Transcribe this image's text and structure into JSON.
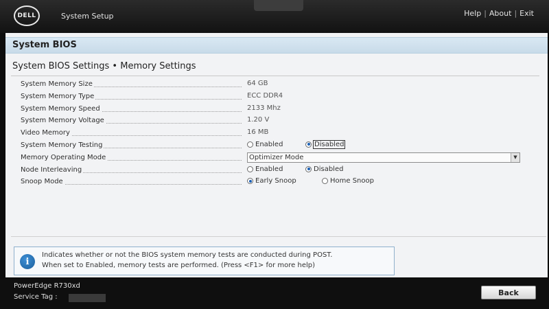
{
  "header": {
    "logo_text": "DELL",
    "app_title": "System Setup",
    "links": {
      "help": "Help",
      "about": "About",
      "exit": "Exit"
    },
    "separator": "|"
  },
  "section": {
    "title": "System BIOS"
  },
  "page": {
    "title": "System BIOS Settings • Memory Settings"
  },
  "settings": {
    "memory_size": {
      "label": "System Memory Size",
      "value": "64 GB"
    },
    "memory_type": {
      "label": "System Memory Type",
      "value": "ECC DDR4"
    },
    "memory_speed": {
      "label": "System Memory Speed",
      "value": "2133 Mhz"
    },
    "memory_voltage": {
      "label": "System Memory Voltage",
      "value": "1.20 V"
    },
    "video_memory": {
      "label": "Video Memory",
      "value": "16 MB"
    },
    "memory_testing": {
      "label": "System Memory Testing",
      "options": [
        "Enabled",
        "Disabled"
      ],
      "selected": "Disabled"
    },
    "operating_mode": {
      "label": "Memory Operating Mode",
      "selected": "Optimizer Mode"
    },
    "node_interleaving": {
      "label": "Node Interleaving",
      "options": [
        "Enabled",
        "Disabled"
      ],
      "selected": "Disabled"
    },
    "snoop_mode": {
      "label": "Snoop Mode",
      "options": [
        "Early Snoop",
        "Home Snoop"
      ],
      "selected": "Early Snoop"
    }
  },
  "help": {
    "line1": "Indicates whether or not the BIOS system memory tests are conducted during POST.",
    "line2": "When set to Enabled, memory tests are performed. (Press <F1> for more help)"
  },
  "footer": {
    "model": "PowerEdge R730xd",
    "service_tag_label": "Service Tag :",
    "back_label": "Back"
  },
  "colors": {
    "header_bg": "#1c1c1c",
    "panel_bg": "#f2f3f5",
    "section_header_bg": "#d2e3ef",
    "radio_selected": "#1a5fb4"
  },
  "icons": {
    "info": "info-icon",
    "dropdown": "chevron-down-icon"
  }
}
